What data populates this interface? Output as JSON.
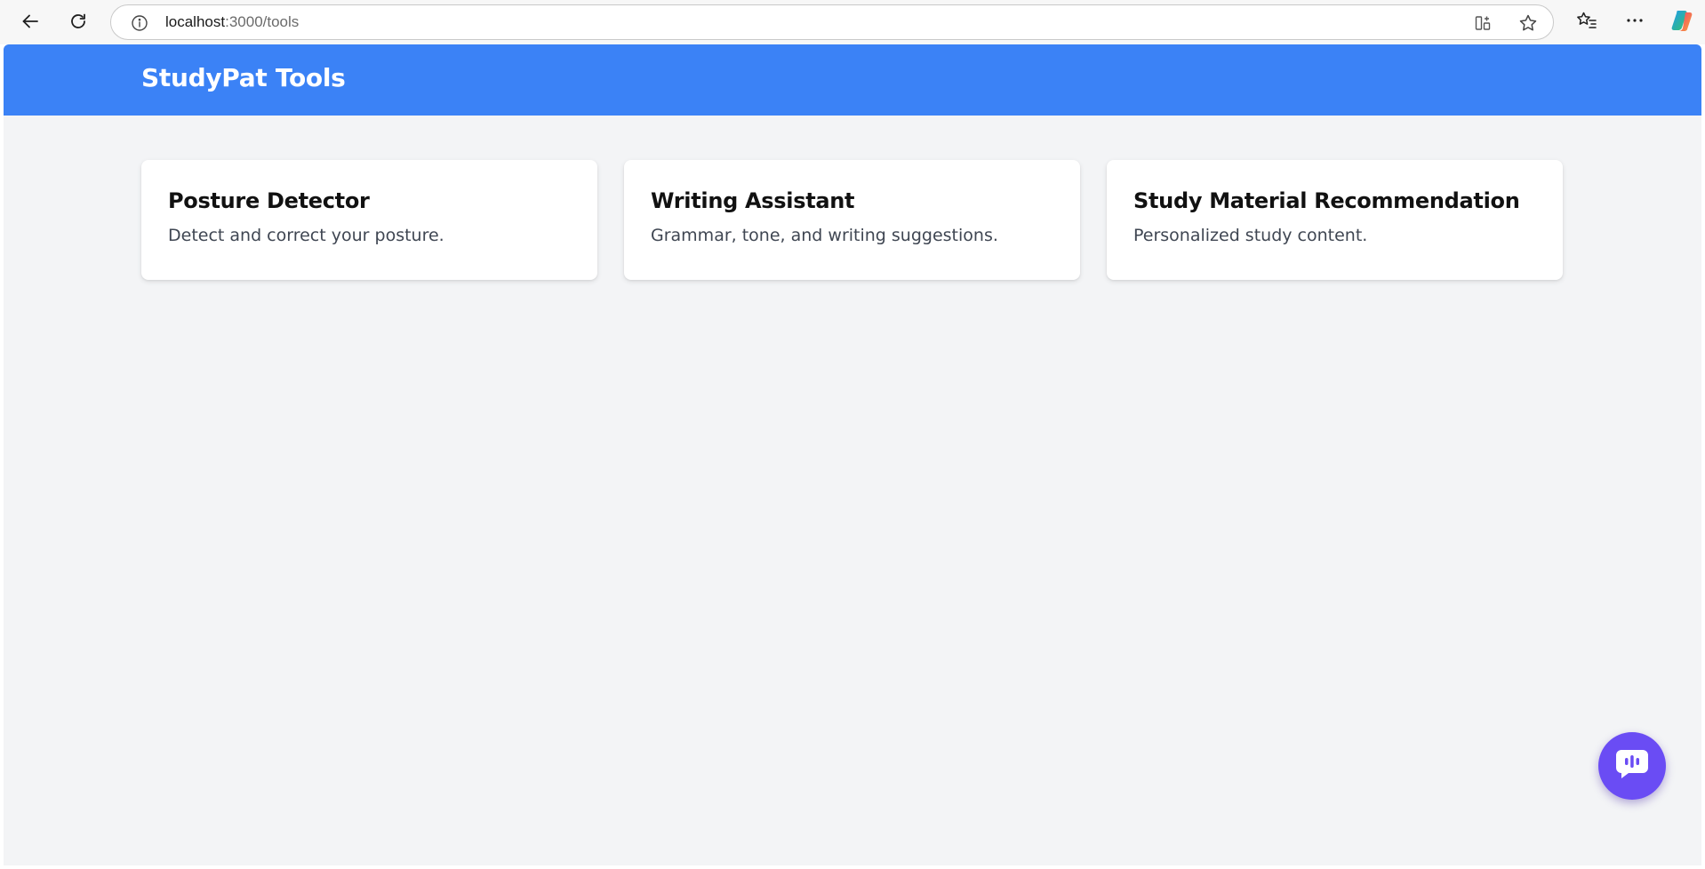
{
  "browser": {
    "url_host": "localhost",
    "url_path": ":3000/tools",
    "icons": {
      "back": "back-arrow-icon",
      "reload": "reload-icon",
      "site_info": "info-icon",
      "split_screen": "split-screen-icon",
      "favorite": "star-icon",
      "favorites_list": "favorites-icon",
      "more": "more-options-icon",
      "copilot": "copilot-icon"
    }
  },
  "header": {
    "title": "StudyPat Tools",
    "background_color": "#3b82f6"
  },
  "tools": [
    {
      "title": "Posture Detector",
      "description": "Detect and correct your posture."
    },
    {
      "title": "Writing Assistant",
      "description": "Grammar, tone, and writing suggestions."
    },
    {
      "title": "Study Material Recommendation",
      "description": "Personalized study content."
    }
  ],
  "chat_button": {
    "icon": "chat-icon",
    "color": "#6a4cf4"
  },
  "colors": {
    "page_background": "#f3f4f6",
    "card_background": "#ffffff"
  }
}
